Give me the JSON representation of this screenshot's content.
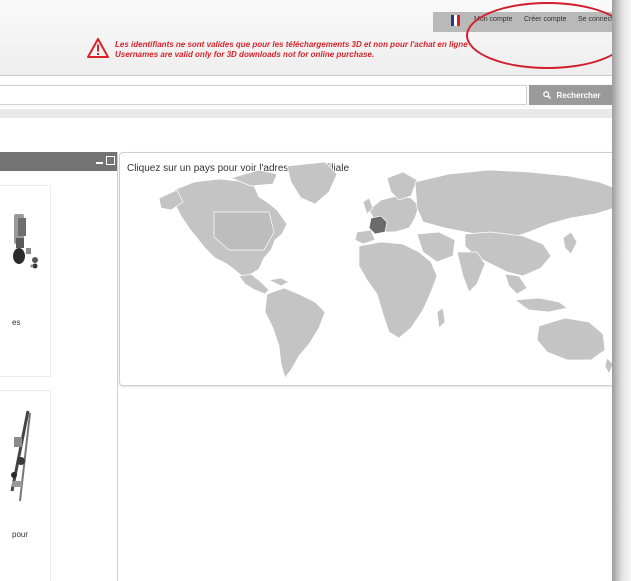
{
  "header": {
    "user_links": {
      "account": "Mon compte",
      "create_account": "Créer compte",
      "login": "Se connect"
    },
    "language_flag": "France",
    "warning": {
      "icon": "warning-triangle-icon",
      "line_fr": "Les identifiants ne sont valides que pour les téléchargements 3D et non pour l'achat en ligne",
      "line_en": "Usernames are valid only for 3D downloads not for online purchase."
    }
  },
  "search": {
    "value": "",
    "placeholder": "",
    "button_label": "Rechercher",
    "icon": "search-icon"
  },
  "left_panel": {
    "products": [
      {
        "label_fragment": "es"
      },
      {
        "label_fragment": "pour"
      }
    ]
  },
  "map_panel": {
    "title": "Cliquez sur un pays pour voir l'adresse de la filiale",
    "highlighted_country": "France"
  },
  "colors": {
    "warning_red": "#d8232a",
    "panel_header": "#737373",
    "map_land": "#c4c4c4",
    "map_selected": "#6b6b6b",
    "search_button": "#9a9a9a",
    "highlight_ring": "#d0202e",
    "flag_blue": "#1f3a93",
    "flag_white": "#ffffff",
    "flag_red": "#d0202e"
  }
}
